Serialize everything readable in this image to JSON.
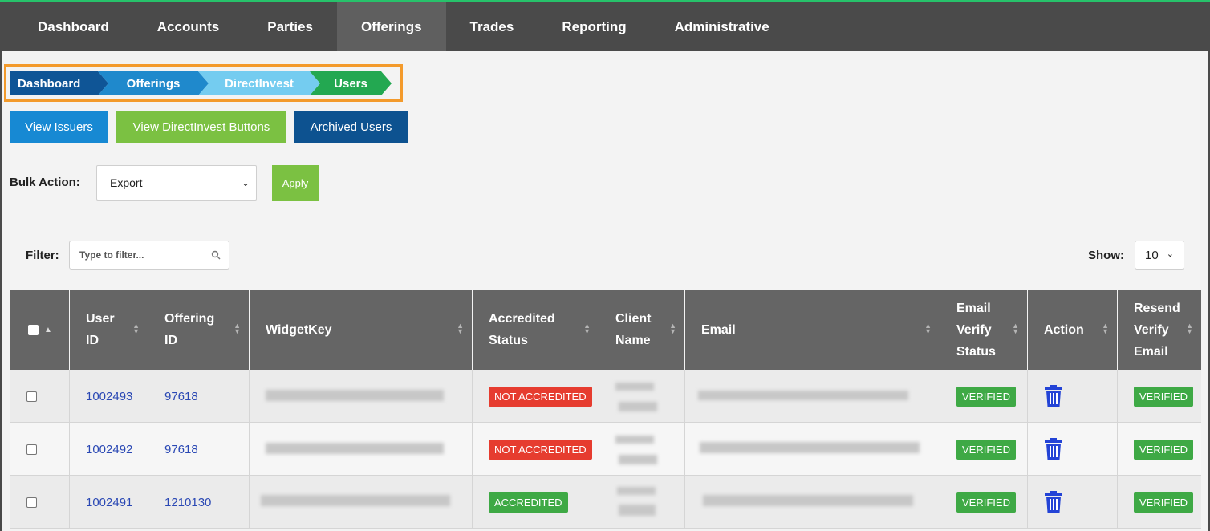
{
  "nav": {
    "items": [
      {
        "label": "Dashboard",
        "active": false
      },
      {
        "label": "Accounts",
        "active": false
      },
      {
        "label": "Parties",
        "active": false
      },
      {
        "label": "Offerings",
        "active": true
      },
      {
        "label": "Trades",
        "active": false
      },
      {
        "label": "Reporting",
        "active": false
      },
      {
        "label": "Administrative",
        "active": false
      }
    ]
  },
  "breadcrumb": [
    "Dashboard",
    "Offerings",
    "DirectInvest",
    "Users"
  ],
  "buttons": {
    "view_issuers": "View Issuers",
    "view_directinvest_buttons": "View DirectInvest Buttons",
    "archived_users": "Archived Users"
  },
  "bulk": {
    "label": "Bulk Action:",
    "selected": "Export",
    "apply": "Apply"
  },
  "filter": {
    "label": "Filter:",
    "placeholder": "Type to filter..."
  },
  "show": {
    "label": "Show:",
    "value": "10"
  },
  "table": {
    "columns": [
      {
        "key": "select",
        "label": ""
      },
      {
        "key": "user_id",
        "label": "User ID"
      },
      {
        "key": "offering_id",
        "label": "Offering ID"
      },
      {
        "key": "widget_key",
        "label": "WidgetKey"
      },
      {
        "key": "accredited_status",
        "label": "Accredited Status"
      },
      {
        "key": "client_name",
        "label": "Client Name"
      },
      {
        "key": "email",
        "label": "Email"
      },
      {
        "key": "email_verify_status",
        "label": "Email Verify Status"
      },
      {
        "key": "action",
        "label": "Action"
      },
      {
        "key": "resend_verify_email",
        "label": "Resend Verify Email"
      }
    ],
    "rows": [
      {
        "user_id": "1002493",
        "offering_id": "97618",
        "accredited_status": "NOT ACCREDITED",
        "email_verify_status": "VERIFIED",
        "resend": "VERIFIED"
      },
      {
        "user_id": "1002492",
        "offering_id": "97618",
        "accredited_status": "NOT ACCREDITED",
        "email_verify_status": "VERIFIED",
        "resend": "VERIFIED"
      },
      {
        "user_id": "1002491",
        "offering_id": "1210130",
        "accredited_status": "ACCREDITED",
        "email_verify_status": "VERIFIED",
        "resend": "VERIFIED"
      }
    ]
  },
  "colors": {
    "nav_bg": "#4a4a4a",
    "accent_green": "#7bc142",
    "badge_red": "#e63c2f",
    "badge_green": "#3ea945",
    "link": "#2a48b4",
    "trash_icon": "#2343d6"
  }
}
